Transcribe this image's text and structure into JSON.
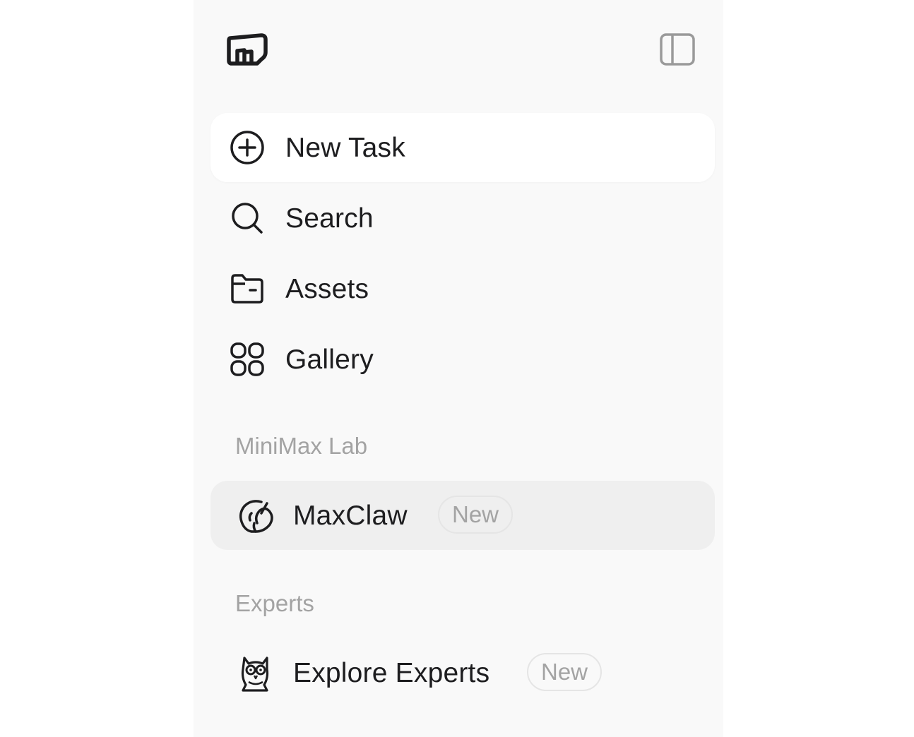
{
  "sidebar": {
    "logo_icon": "minimax-logo-icon",
    "toggle_icon": "sidebar-toggle-icon",
    "nav": {
      "new_task": {
        "label": "New Task",
        "icon": "plus-circle-icon"
      },
      "search": {
        "label": "Search",
        "icon": "search-icon"
      },
      "assets": {
        "label": "Assets",
        "icon": "folder-icon"
      },
      "gallery": {
        "label": "Gallery",
        "icon": "grid-icon"
      }
    },
    "sections": {
      "lab": {
        "title": "MiniMax Lab",
        "item": {
          "label": "MaxClaw",
          "badge": "New",
          "icon": "claw-icon"
        }
      },
      "experts": {
        "title": "Experts",
        "item": {
          "label": "Explore Experts",
          "badge": "New",
          "icon": "owl-icon"
        }
      }
    },
    "colors": {
      "background": "#f9f9f9",
      "active_item": "#efefef",
      "muted_text": "#a3a3a3",
      "text": "#1d1d1f"
    }
  }
}
